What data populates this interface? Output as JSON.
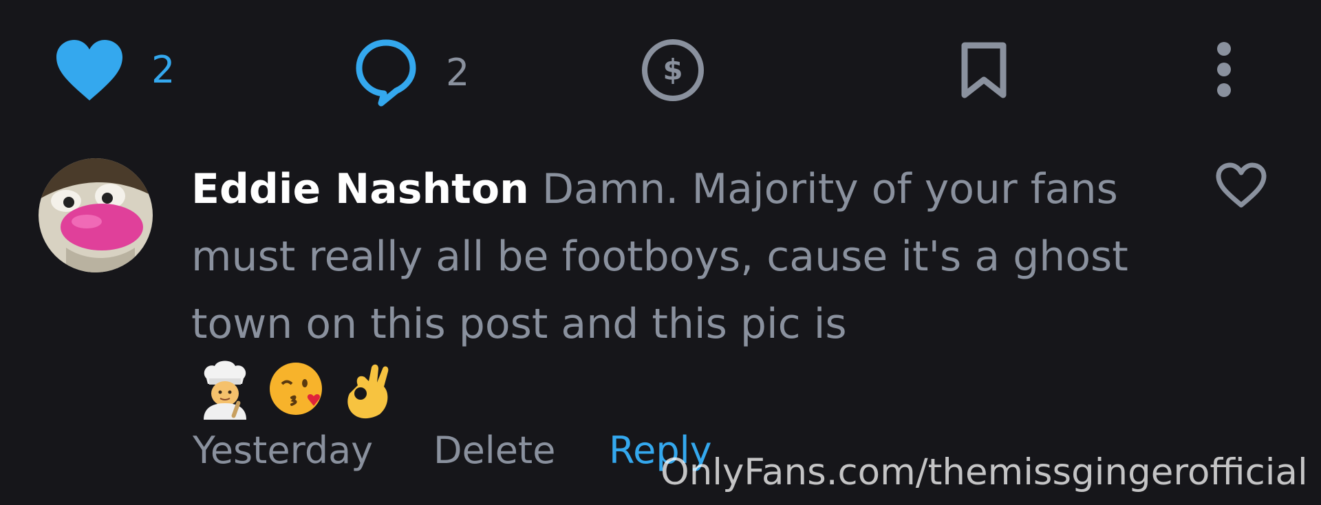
{
  "actions": {
    "like": {
      "icon": "heart-filled-icon",
      "count": "2",
      "color": "#34a8ee"
    },
    "comment": {
      "icon": "speech-bubble-icon",
      "count": "2",
      "color": "#34a8ee"
    },
    "tip": {
      "icon": "dollar-circle-icon"
    },
    "bookmark": {
      "icon": "bookmark-icon"
    },
    "more": {
      "icon": "vertical-dots-icon"
    }
  },
  "comment": {
    "author": "Eddie Nashton",
    "text": " Damn. Majority of your fans must really all be footboys, cause it's a ghost town on this post and this pic is",
    "emojis": [
      "chef-emoji",
      "kiss-wink-emoji",
      "ok-hand-emoji"
    ],
    "timestamp": "Yesterday",
    "delete_label": "Delete",
    "reply_label": "Reply",
    "like_icon": "heart-outline-icon"
  },
  "watermark": "OnlyFans.com/themissgingerofficial",
  "colors": {
    "background": "#16161a",
    "accent": "#34a8ee",
    "muted": "#8a919e",
    "icon_gray": "#8a919e"
  }
}
